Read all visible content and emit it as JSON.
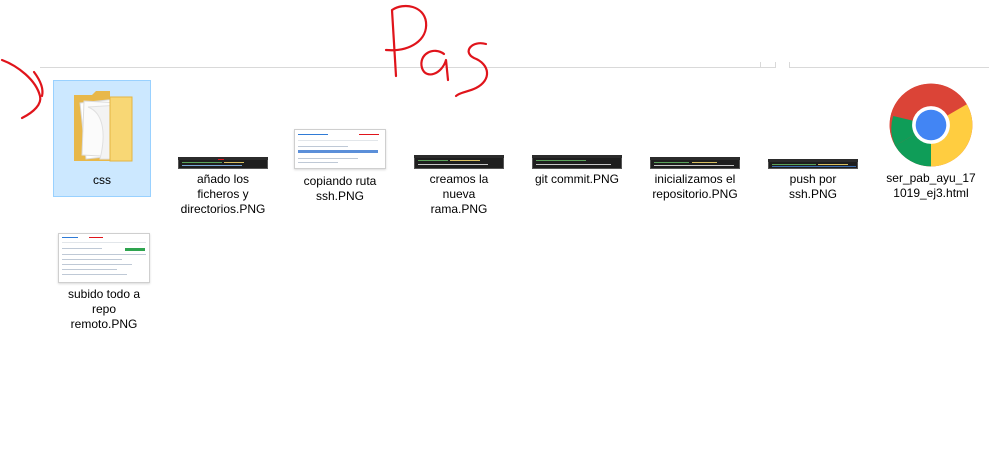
{
  "annotation": {
    "handwritten_text": "Pas",
    "ink_color": "#e0141b"
  },
  "explorer": {
    "view": "large-icons",
    "selected_item": "css",
    "items": [
      {
        "name": "css",
        "kind": "folder",
        "icon": "folder-icon"
      },
      {
        "name": "añado los ficheros y directorios.PNG",
        "kind": "png",
        "icon": "image-thumbnail-terminal"
      },
      {
        "name": "copiando ruta ssh.PNG",
        "kind": "png",
        "icon": "image-thumbnail-browser"
      },
      {
        "name": "creamos la nueva rama.PNG",
        "kind": "png",
        "icon": "image-thumbnail-terminal"
      },
      {
        "name": "git commit.PNG",
        "kind": "png",
        "icon": "image-thumbnail-terminal"
      },
      {
        "name": "inicializamos el repositorio.PNG",
        "kind": "png",
        "icon": "image-thumbnail-terminal"
      },
      {
        "name": "push por ssh.PNG",
        "kind": "png",
        "icon": "image-thumbnail-terminal"
      },
      {
        "name": "ser_pab_ayu_171019_ej3.html",
        "kind": "html",
        "icon": "chrome-icon"
      },
      {
        "name": "subido todo a repo remoto.PNG",
        "kind": "png",
        "icon": "image-thumbnail-browser"
      }
    ]
  },
  "colors": {
    "selection_bg": "#cce8ff",
    "selection_border": "#99d1ff"
  }
}
